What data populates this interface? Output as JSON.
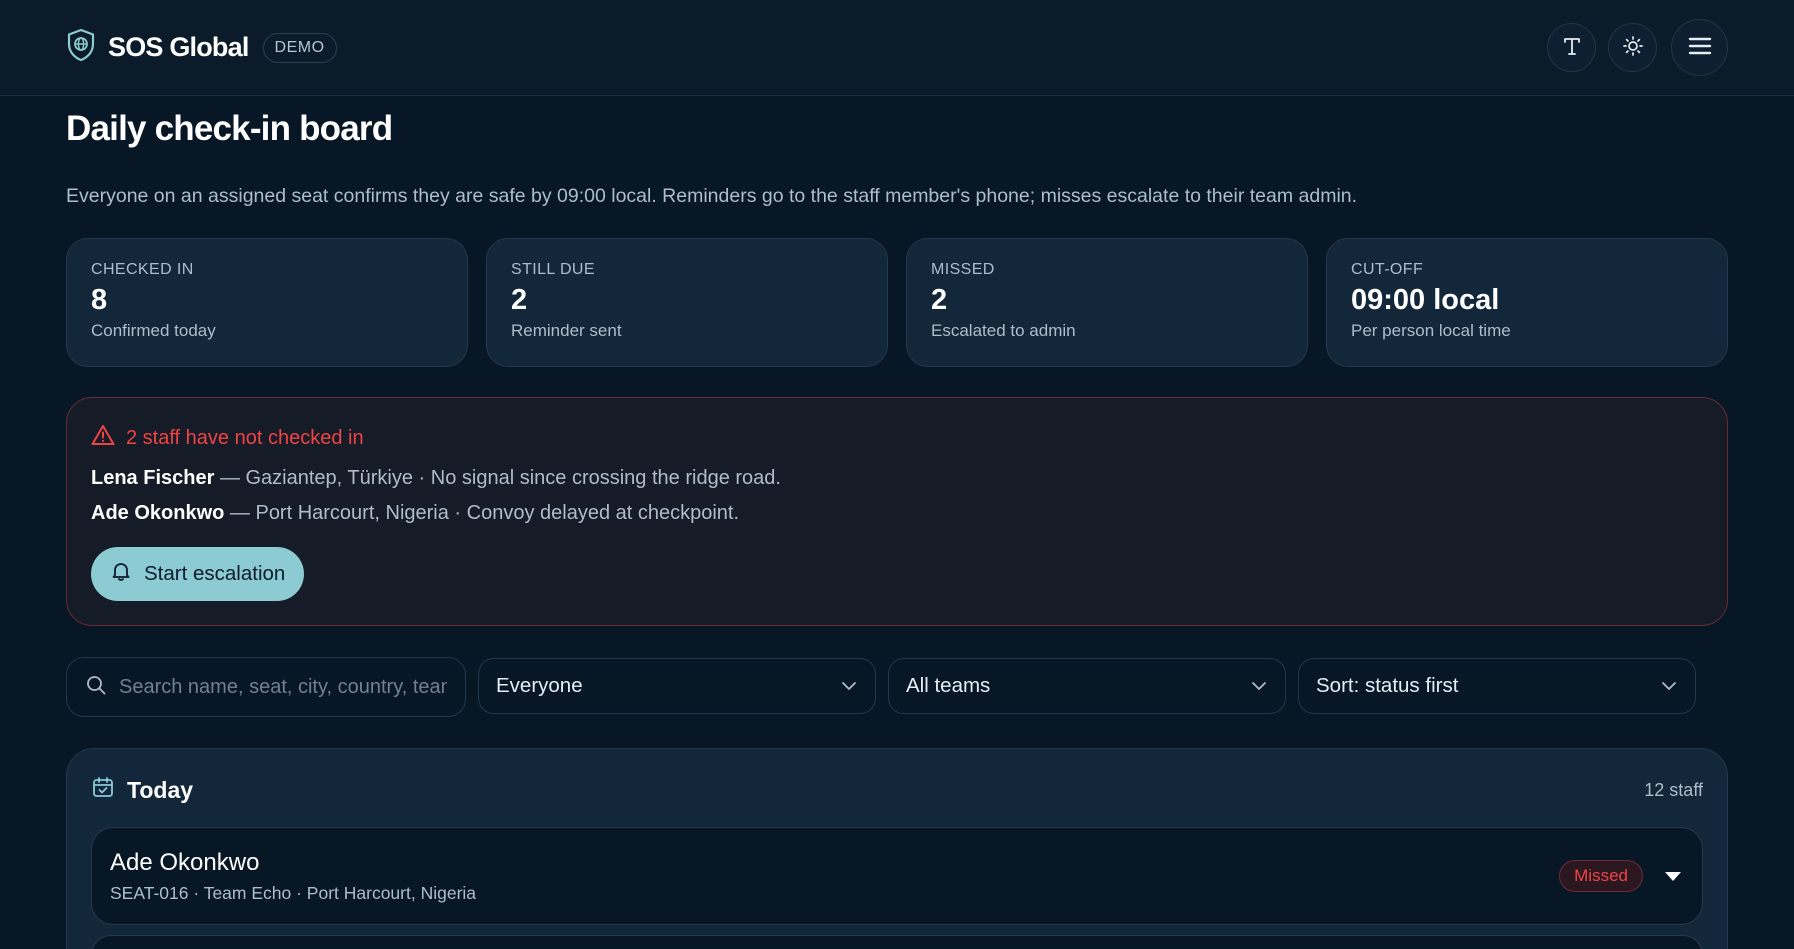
{
  "header": {
    "brand": "SOS Global",
    "badge": "DEMO",
    "icons": [
      "shield-globe-icon",
      "text-size-icon",
      "sun-icon",
      "menu-icon"
    ]
  },
  "page": {
    "title": "Daily check-in board",
    "intro": "Everyone on an assigned seat confirms they are safe by 09:00 local. Reminders go to the staff member's phone; misses escalate to their team admin."
  },
  "stats": [
    {
      "label": "CHECKED IN",
      "value": "8",
      "sub": "Confirmed today"
    },
    {
      "label": "STILL DUE",
      "value": "2",
      "sub": "Reminder sent"
    },
    {
      "label": "MISSED",
      "value": "2",
      "sub": "Escalated to admin"
    },
    {
      "label": "CUT-OFF",
      "value": "09:00 local",
      "sub": "Per person local time"
    }
  ],
  "alert": {
    "title": "2 staff have not checked in",
    "items": [
      {
        "name": "Lena Fischer",
        "detail": " — Gaziantep, Türkiye · No signal since crossing the ridge road."
      },
      {
        "name": "Ade Okonkwo",
        "detail": " — Port Harcourt, Nigeria · Convoy delayed at checkpoint."
      }
    ],
    "button": "Start escalation"
  },
  "filters": {
    "search_placeholder": "Search name, seat, city, country, team",
    "who": "Everyone",
    "team": "All teams",
    "sort": "Sort: status first"
  },
  "today": {
    "title": "Today",
    "count": "12 staff",
    "rows": [
      {
        "name": "Ade Okonkwo",
        "meta": "SEAT-016 · Team Echo · Port Harcourt, Nigeria",
        "status": "Missed"
      }
    ]
  },
  "colors": {
    "background": "#071726",
    "card": "#13273a",
    "accent": "#8ccbd1",
    "danger": "#ef4444"
  }
}
